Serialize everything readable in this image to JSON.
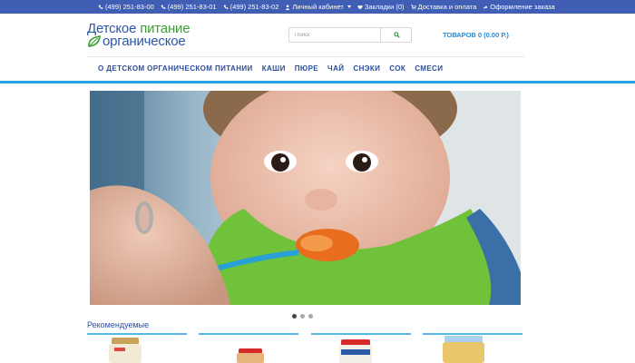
{
  "topbar": {
    "phones": [
      "(499) 251-83-00",
      "(499) 251-83-01",
      "(499) 251-83-02"
    ],
    "account": "Личный кабинет",
    "bookmarks": "Закладки (0)",
    "delivery": "Доставка и оплата",
    "checkout": "Оформление заказа"
  },
  "logo": {
    "word1": "Детское",
    "word2": "питание",
    "line2": "органическое"
  },
  "search": {
    "placeholder": "Поиск"
  },
  "cart": {
    "label": "ТОВАРОВ 0 (0.00 Р.)"
  },
  "nav": {
    "items": [
      "О ДЕТСКОМ ОРГАНИЧЕСКОМ ПИТАНИИ",
      "КАШИ",
      "ПЮРЕ",
      "ЧАЙ",
      "СНЭКИ",
      "СОК",
      "СМЕСИ"
    ]
  },
  "slider": {
    "count": 3,
    "active": 1
  },
  "recommended": {
    "title": "Рекомендуемые"
  },
  "colors": {
    "topbar": "#3f5eb4",
    "accent": "#27a4e3",
    "nav": "#2b4d9c",
    "logo_green": "#3a9f35",
    "cart": "#2789d6"
  }
}
